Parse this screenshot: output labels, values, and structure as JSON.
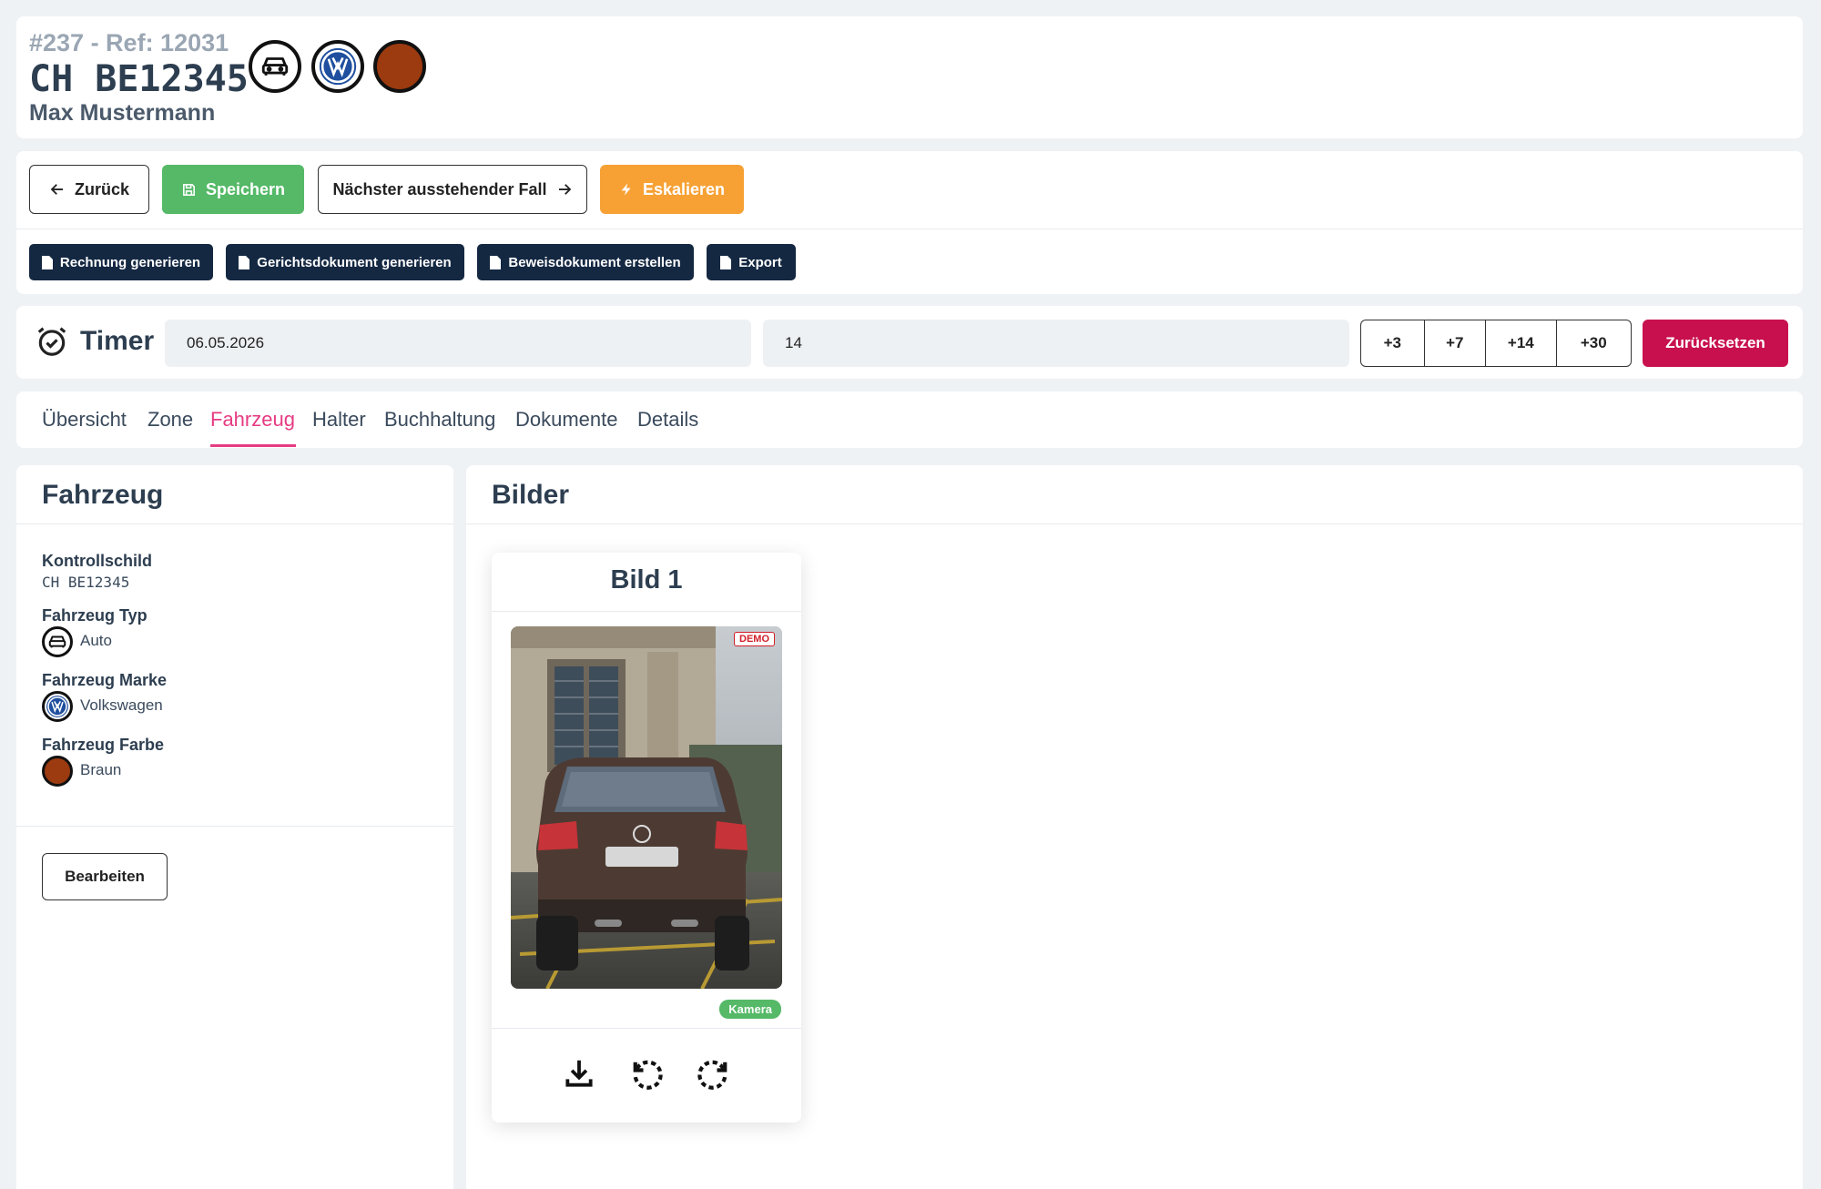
{
  "header": {
    "case_ref": "#237 - Ref: 12031",
    "plate": "CH BE12345",
    "owner": "Max Mustermann",
    "icons": [
      "car-icon",
      "volkswagen-logo-icon",
      "brown-color-swatch"
    ]
  },
  "actions": {
    "back": "Zurück",
    "save": "Speichern",
    "next_case": "Nächster ausstehender Fall",
    "escalate": "Eskalieren",
    "documents": [
      "Rechnung generieren",
      "Gerichtsdokument generieren",
      "Beweisdokument erstellen",
      "Export"
    ]
  },
  "timer": {
    "label": "Timer",
    "date_value": "06.05.2026",
    "days_value": "14",
    "steps": [
      "+3",
      "+7",
      "+14",
      "+30"
    ],
    "reset": "Zurücksetzen"
  },
  "tabs": {
    "items": [
      "Übersicht",
      "Zone",
      "Fahrzeug",
      "Halter",
      "Buchhaltung",
      "Dokumente",
      "Details"
    ],
    "active": "Fahrzeug"
  },
  "vehicle": {
    "title": "Fahrzeug",
    "plate_label": "Kontrollschild",
    "plate_value": "CH BE12345",
    "type_label": "Fahrzeug Typ",
    "type_value": "Auto",
    "brand_label": "Fahrzeug Marke",
    "brand_value": "Volkswagen",
    "color_label": "Fahrzeug Farbe",
    "color_value": "Braun",
    "edit": "Bearbeiten"
  },
  "images": {
    "title": "Bilder",
    "card_title": "Bild 1",
    "demo_tag": "DEMO",
    "source_badge": "Kamera"
  },
  "colors": {
    "save_green": "#55b967",
    "escalate_orange": "#f7a135",
    "reset_red": "#c8104e",
    "tab_active": "#e63b82",
    "doc_button_navy": "#142842",
    "vehicle_brown": "#9c3a10"
  }
}
